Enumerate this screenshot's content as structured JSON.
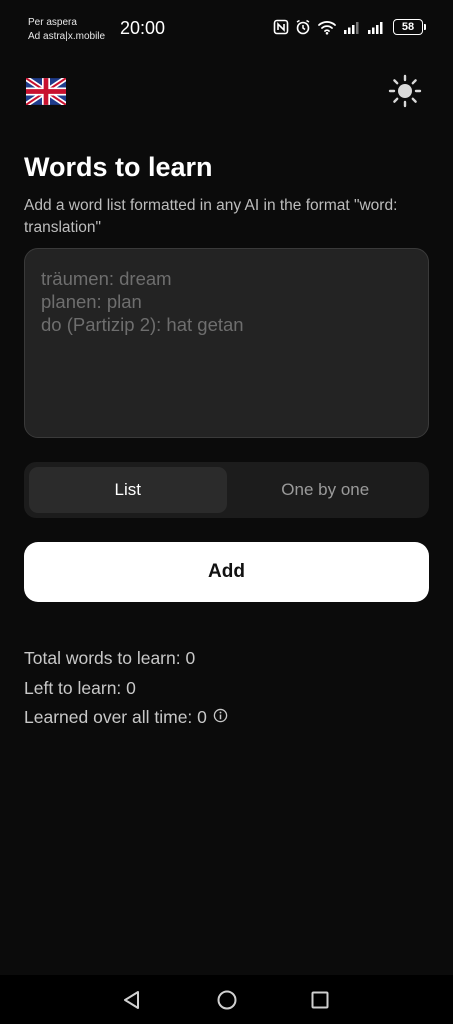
{
  "status_bar": {
    "carrier_line1": "Per aspera",
    "carrier_line2": "Ad astra|x.mobile",
    "time": "20:00",
    "battery": "58",
    "icons": [
      "nfc-icon",
      "alarm-icon",
      "wifi-icon",
      "signal-icon",
      "signal-icon",
      "battery-icon"
    ]
  },
  "header": {
    "language_icon": "uk-flag-icon",
    "theme_icon": "sun-icon"
  },
  "main": {
    "title": "Words to learn",
    "subtitle": "Add a word list formatted in any AI in the format \"word: translation\"",
    "input_placeholder": "träumen: dream\nplanen: plan\ndo (Partizip 2): hat getan",
    "input_value": "",
    "mode_tabs": [
      {
        "label": "List",
        "selected": true
      },
      {
        "label": "One by one",
        "selected": false
      }
    ],
    "add_label": "Add"
  },
  "stats": {
    "total": "Total words to learn: 0",
    "left": "Left to learn: 0",
    "learned": "Learned over all time: 0"
  },
  "nav": {
    "back_icon": "back-icon",
    "home_icon": "home-icon",
    "recents_icon": "recents-icon"
  },
  "colors": {
    "background": "#0b0b0b",
    "input_bg": "#232323",
    "primary_button": "#ffffff"
  }
}
